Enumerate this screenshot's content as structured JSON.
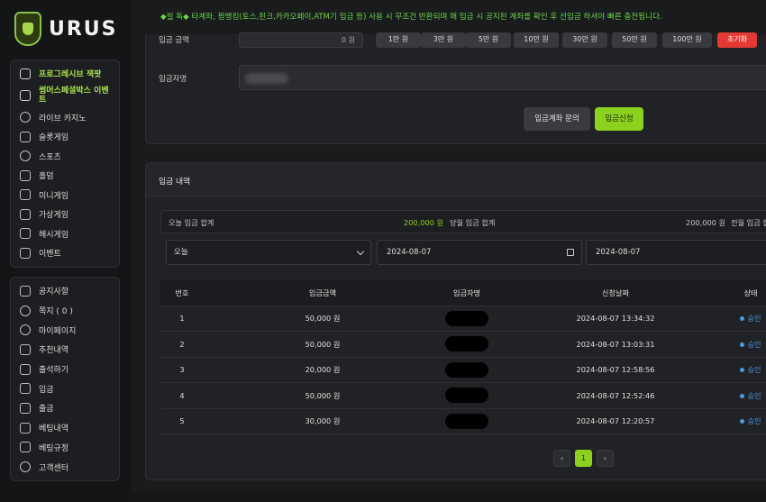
{
  "brand": {
    "name": "URUS"
  },
  "notice": "◆필 독◆ 타계좌, 펌뱅킹(토스,핀크,카카오페이,ATM기 입금 등) 사용 시 무조건 반환되며 매 입금 시 공지된 계좌를 확인 후 선입금 하셔야 빠른 충전됩니다.",
  "sidebar": {
    "group1": [
      {
        "label": "프로그레시브 잭팟",
        "icon": "gift-icon",
        "highlight": true
      },
      {
        "label": "썸머스페셜박스 이벤트",
        "icon": "gift-box-icon",
        "highlight": true
      },
      {
        "label": "라이브 카지노",
        "icon": "casino-chip-icon",
        "highlight": false
      },
      {
        "label": "슬롯게임",
        "icon": "slot-machine-icon",
        "highlight": false
      },
      {
        "label": "스포츠",
        "icon": "soccer-ball-icon",
        "highlight": false
      },
      {
        "label": "홀덤",
        "icon": "poker-cards-icon",
        "highlight": false
      },
      {
        "label": "미니게임",
        "icon": "gamepad-icon",
        "highlight": false
      },
      {
        "label": "가상게임",
        "icon": "vr-headset-icon",
        "highlight": false
      },
      {
        "label": "해시게임",
        "icon": "hash-icon",
        "highlight": false
      },
      {
        "label": "이벤트",
        "icon": "event-gift-icon",
        "highlight": false
      }
    ],
    "group2": [
      {
        "label": "공지사항",
        "icon": "megaphone-icon"
      },
      {
        "label": "쪽지 ( 0 )",
        "icon": "message-icon"
      },
      {
        "label": "마이페이지",
        "icon": "user-icon"
      },
      {
        "label": "추천내역",
        "icon": "referral-icon"
      },
      {
        "label": "출석하기",
        "icon": "calendar-check-icon"
      },
      {
        "label": "입금",
        "icon": "deposit-icon"
      },
      {
        "label": "출금",
        "icon": "withdraw-icon"
      },
      {
        "label": "베팅내역",
        "icon": "list-icon"
      },
      {
        "label": "베팅규정",
        "icon": "rules-icon"
      },
      {
        "label": "고객센터",
        "icon": "headset-icon"
      }
    ]
  },
  "form": {
    "amount_label": "입금 금액",
    "amount_value": "0 원",
    "quick_buttons": [
      "1만 원",
      "3만 원",
      "5만 원",
      "10만 원",
      "30만 원",
      "50만 원",
      "100만 원"
    ],
    "reset_label": "초기화",
    "name_label": "입금자명",
    "inquiry_label": "입금계좌 문의",
    "apply_label": "입금신청"
  },
  "history": {
    "title": "입금 내역",
    "today_total_label": "오늘 입금 합계",
    "today_total_value": "200,000 원",
    "month_total_label": "당월 입금 합계",
    "month_total_value": "200,000 원",
    "all_total_label": "전월 입금 합",
    "period_select": "오늘",
    "date_from": "2024-08-07",
    "date_to": "2024-08-07",
    "columns": [
      "번호",
      "입금금액",
      "입금자명",
      "신청날짜",
      "상태"
    ],
    "rows": [
      {
        "no": "1",
        "amount": "50,000 원",
        "date": "2024-08-07 13:34:32",
        "status": "승인"
      },
      {
        "no": "2",
        "amount": "50,000 원",
        "date": "2024-08-07 13:03:31",
        "status": "승인"
      },
      {
        "no": "3",
        "amount": "20,000 원",
        "date": "2024-08-07 12:58:56",
        "status": "승인"
      },
      {
        "no": "4",
        "amount": "50,000 원",
        "date": "2024-08-07 12:52:46",
        "status": "승인"
      },
      {
        "no": "5",
        "amount": "30,000 원",
        "date": "2024-08-07 12:20:57",
        "status": "승인"
      }
    ],
    "pagination": {
      "prev": "‹",
      "current": "1",
      "next": "›"
    }
  },
  "colors": {
    "accent": "#8bd11d",
    "notice": "#6ad44a",
    "danger": "#e53935",
    "status": "#4a9be6"
  }
}
